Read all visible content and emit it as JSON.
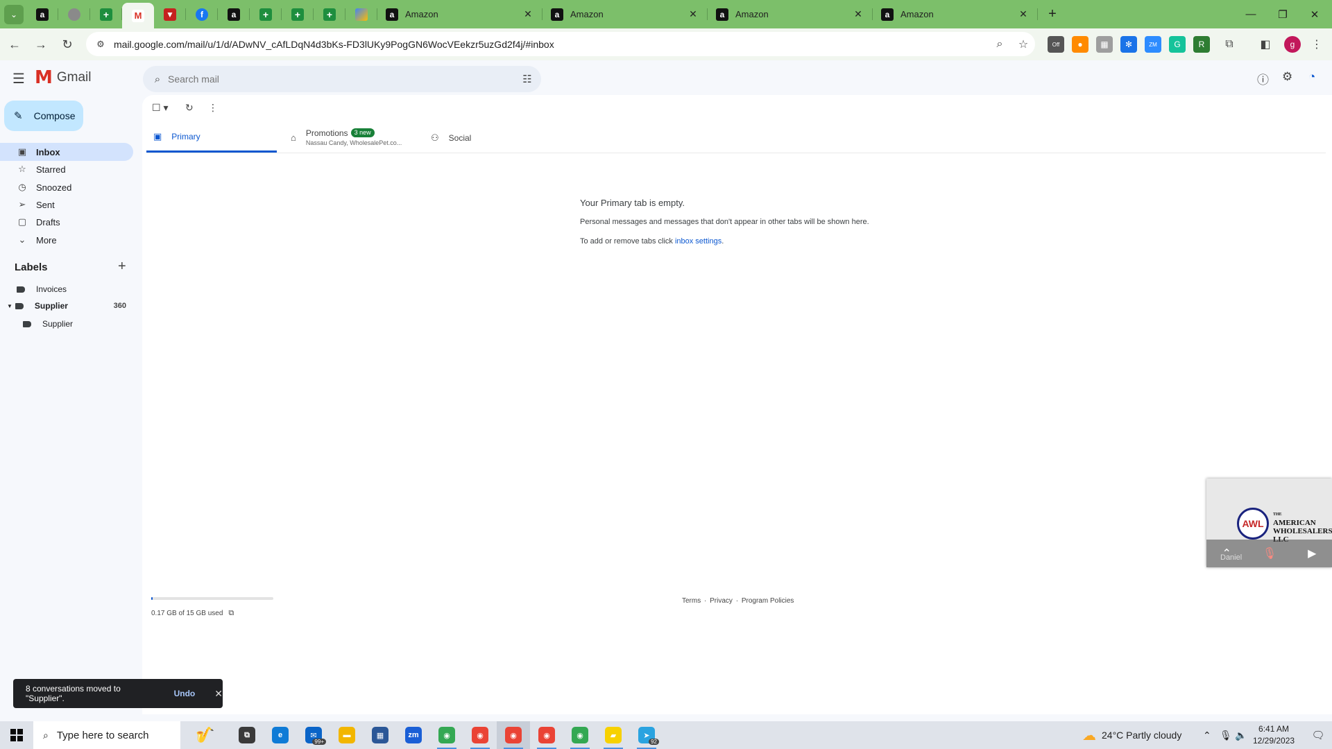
{
  "browser": {
    "pinned_tabs": [
      {
        "icon": "amazon-icon",
        "glyph": "a"
      },
      {
        "icon": "gray-circle-icon",
        "glyph": ""
      },
      {
        "icon": "sheets-icon",
        "glyph": "+"
      },
      {
        "icon": "gmail-icon",
        "glyph": "M",
        "active": true
      },
      {
        "icon": "red-flag-icon",
        "glyph": "▼"
      },
      {
        "icon": "facebook-icon",
        "glyph": "f"
      },
      {
        "icon": "amazon-icon",
        "glyph": "a"
      },
      {
        "icon": "sheets-icon",
        "glyph": "+"
      },
      {
        "icon": "sheets-icon",
        "glyph": "+"
      },
      {
        "icon": "sheets-icon",
        "glyph": "+"
      },
      {
        "icon": "multicolor-icon",
        "glyph": ""
      }
    ],
    "tabs": [
      {
        "title": "Amazon"
      },
      {
        "title": "Amazon"
      },
      {
        "title": "Amazon"
      },
      {
        "title": "Amazon"
      }
    ],
    "url": "mail.google.com/mail/u/1/d/ADwNV_cAfLDqN4d3bKs-FD3lUKy9PogGN6WocVEekzr5uzGd2f4j/#inbox",
    "profile_initial": "g",
    "extensions": [
      {
        "name": "off-extension-icon",
        "glyph": "Off",
        "color": "#555555"
      },
      {
        "name": "orange-circle-icon",
        "glyph": "●",
        "color": "#ff8a00"
      },
      {
        "name": "image-extension-icon",
        "glyph": "▦",
        "color": "#9e9e9e"
      },
      {
        "name": "blue-gear-icon",
        "glyph": "✻",
        "color": "#1a73e8"
      },
      {
        "name": "zm-extension-icon",
        "glyph": "ZM",
        "color": "#2d8cff"
      },
      {
        "name": "grammarly-icon",
        "glyph": "G",
        "color": "#15c39a"
      },
      {
        "name": "rs-extension-icon",
        "glyph": "R",
        "color": "#2e7d32"
      }
    ]
  },
  "gmail": {
    "app_name": "Gmail",
    "search": {
      "placeholder": "Search mail"
    },
    "compose_label": "Compose",
    "nav": [
      {
        "label": "Inbox",
        "icon": "inbox-icon",
        "glyph": "▣",
        "active": true
      },
      {
        "label": "Starred",
        "icon": "star-icon",
        "glyph": "☆"
      },
      {
        "label": "Snoozed",
        "icon": "clock-icon",
        "glyph": "◷"
      },
      {
        "label": "Sent",
        "icon": "send-icon",
        "glyph": "➢"
      },
      {
        "label": "Drafts",
        "icon": "draft-icon",
        "glyph": "▢"
      },
      {
        "label": "More",
        "icon": "chevron-down-icon",
        "glyph": "⌄"
      }
    ],
    "labels_heading": "Labels",
    "labels": [
      {
        "label": "Invoices",
        "count": "",
        "bold": false,
        "indent": 0
      },
      {
        "label": "Supplier",
        "count": "360",
        "bold": true,
        "indent": 0,
        "expanded": true
      },
      {
        "label": "Supplier",
        "count": "",
        "bold": false,
        "indent": 1
      }
    ],
    "category_tabs": {
      "primary": "Primary",
      "promotions": "Promotions",
      "promotions_badge": "3 new",
      "promotions_senders": "Nassau Candy, WholesalePet.co...",
      "social": "Social"
    },
    "empty_state": {
      "title": "Your Primary tab is empty.",
      "description": "Personal messages and messages that don't appear in other tabs will be shown here.",
      "settings_prefix": "To add or remove tabs click ",
      "settings_link": "inbox settings",
      "settings_suffix": "."
    },
    "storage": {
      "text": "0.17 GB of 15 GB used",
      "used_fraction": 0.011
    },
    "footer": {
      "terms": "Terms",
      "privacy": "Privacy",
      "policies": "Program Policies",
      "separator": "·"
    },
    "snackbar": {
      "message": "8 conversations moved to \"Supplier\".",
      "undo": "Undo"
    }
  },
  "video_tile": {
    "logo_text": "AWL",
    "company_lines": [
      "THE",
      "AMERICAN",
      "WHOLESALERS",
      "LLC"
    ],
    "participant": "Daniel"
  },
  "taskbar": {
    "search_placeholder": "Type here to search",
    "apps": [
      {
        "name": "task-view-icon",
        "glyph": "⧉",
        "color": "#3a3a3a"
      },
      {
        "name": "edge-icon",
        "glyph": "e",
        "color": "#0f7bd6"
      },
      {
        "name": "mail-app-icon",
        "glyph": "✉",
        "color": "#0a64c8",
        "badge": "99+"
      },
      {
        "name": "file-explorer-icon",
        "glyph": "▬",
        "color": "#f2b600"
      },
      {
        "name": "store-icon",
        "glyph": "▦",
        "color": "#2b5797"
      },
      {
        "name": "zoom-icon",
        "glyph": "zm",
        "color": "#1a5fd6"
      },
      {
        "name": "chrome-icon",
        "glyph": "◉",
        "color": "#34a853"
      },
      {
        "name": "chrome-icon",
        "glyph": "◉",
        "color": "#ea4335"
      },
      {
        "name": "chrome-icon",
        "glyph": "◉",
        "color": "#ea4335",
        "active": true
      },
      {
        "name": "chrome-icon",
        "glyph": "◉",
        "color": "#ea4335"
      },
      {
        "name": "chrome-icon",
        "glyph": "◉",
        "color": "#34a853"
      },
      {
        "name": "sticky-notes-icon",
        "glyph": "▰",
        "color": "#f7d100"
      },
      {
        "name": "telegram-icon",
        "glyph": "➤",
        "color": "#2aa3e0",
        "badge": "92"
      }
    ],
    "weather": "24°C  Partly cloudy",
    "time": "6:41 AM",
    "date": "12/29/2023"
  }
}
